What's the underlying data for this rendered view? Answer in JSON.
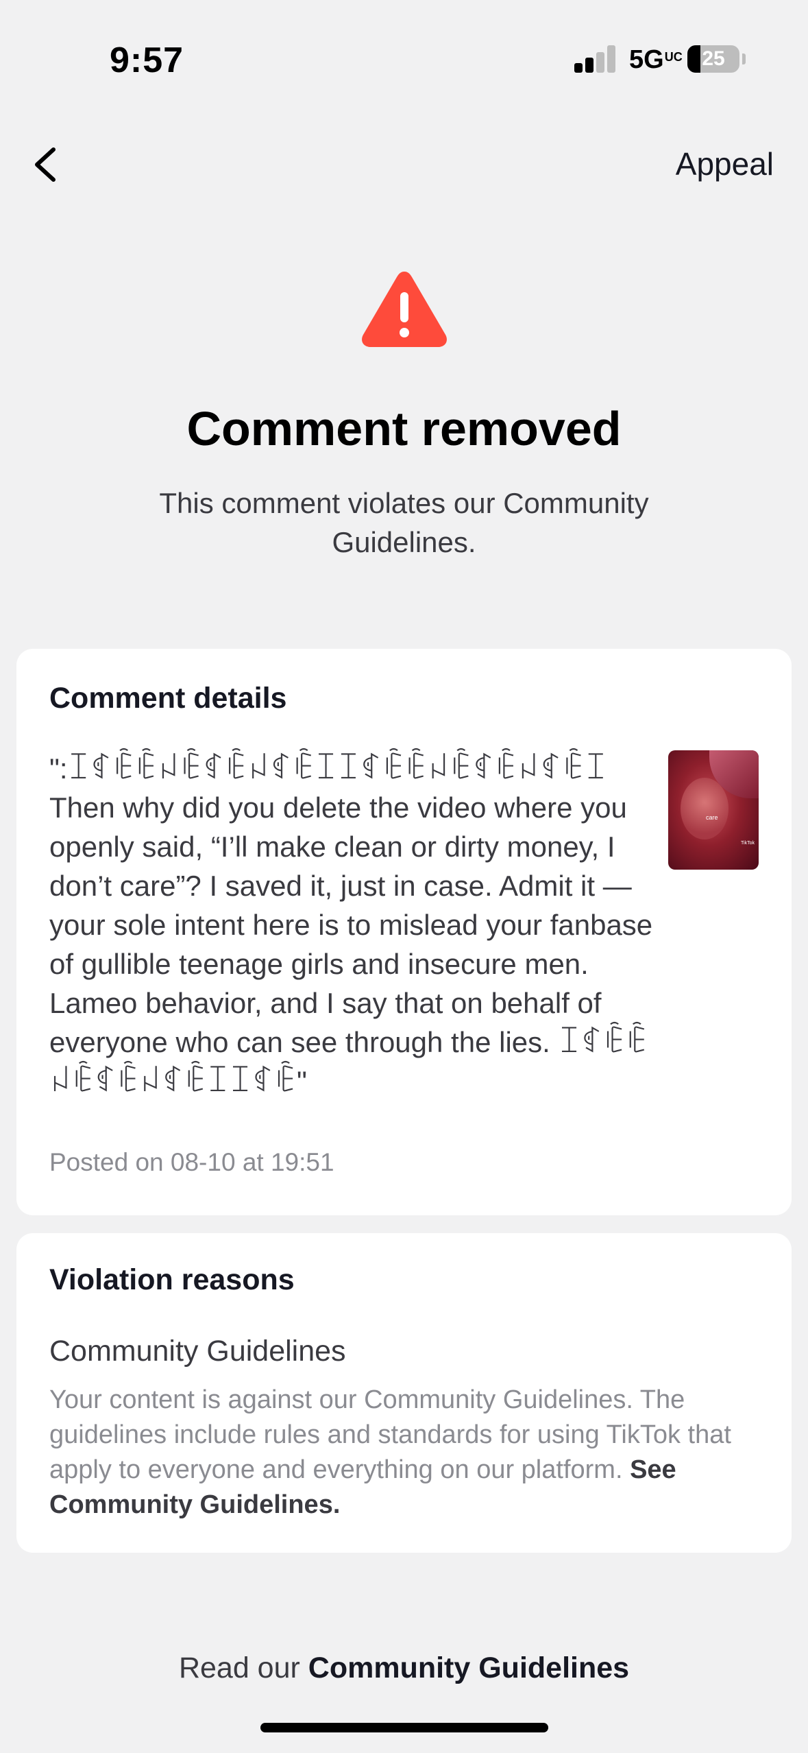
{
  "status_bar": {
    "time": "9:57",
    "network": "5G",
    "network_suffix": "UC",
    "battery_percent": "25",
    "battery_level": 0.25
  },
  "header": {
    "back_icon": "chevron-left-icon",
    "appeal_label": "Appeal"
  },
  "hero": {
    "icon": "warning-triangle-icon",
    "icon_color": "#fe4b3b",
    "title": "Comment removed",
    "subtitle": "This comment violates our Community Guidelines."
  },
  "comment_details": {
    "heading": "Comment details",
    "text": "\":ꀤꁍꍟꍟꈤꍟꁍꍟꈤꁍꍟꀤꀤꁍꍟꍟꈤꍟꁍꍟꈤꁍꍟꀤ Then why did you delete the video where you openly said, “I’ll make clean or dirty money, I don’t care”? I saved it, just in case. Admit it — your sole intent here is to mislead your fanbase of gullible teenage girls and insecure men. Lameo behavior, and I say that on behalf of everyone who can see through the lies. ꀤꁍꍟꍟꈤꍟꁍꍟꈤꁍꍟꀤꀤꁍꍟ\"",
    "thumbnail_caption": "care",
    "thumbnail_logo": "TikTok",
    "posted_on": "Posted on 08-10 at 19:51"
  },
  "violation_reasons": {
    "heading": "Violation reasons",
    "reason_title": "Community Guidelines",
    "reason_description": "Your content is against our Community Guidelines. The guidelines include rules and standards for using TikTok that apply to everyone and everything on our platform. ",
    "reason_link": "See Community Guidelines."
  },
  "footer": {
    "prefix": "Read our ",
    "link": "Community Guidelines"
  }
}
